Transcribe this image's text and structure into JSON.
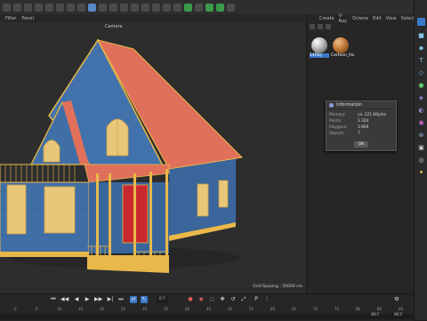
{
  "toolbar": {
    "icons": [
      "undo-icon",
      "move-icon",
      "scale-icon",
      "rotate-icon",
      "mode-icon",
      "brush-icon",
      "x-axis-icon",
      "y-axis-icon",
      "z-axis-icon",
      "coord-icon",
      "render-icon",
      "render-settings-icon",
      "edit-render-icon",
      "cube-icon",
      "pen-icon",
      "subdivide-icon",
      "bend-icon",
      "field-icon",
      "camera-icon",
      "light-icon",
      "brush-tool-icon",
      "snap-icon"
    ]
  },
  "viewport": {
    "menu": [
      "Filter",
      "Panel"
    ],
    "camera_label": "Camera",
    "grid_spacing": "Grid Spacing : 50000 cm"
  },
  "material_panel": {
    "menu": [
      "Create",
      "V-Ray",
      "Octane",
      "Edit",
      "View",
      "Select"
    ],
    "materials": [
      {
        "name": "24Ray",
        "selected": true
      },
      {
        "name": "Cartoon_Ho",
        "selected": false
      }
    ]
  },
  "info_dialog": {
    "title": "Information",
    "rows": [
      {
        "key": "Memory:",
        "value": "ca. 221 KBytes"
      },
      {
        "key": "Points:",
        "value": "3 324"
      },
      {
        "key": "Polygons:",
        "value": "3 869"
      },
      {
        "key": "Objects:",
        "value": "7"
      }
    ],
    "ok_label": "OK"
  },
  "timeline": {
    "current_frame": "0 F",
    "end_frame_1": "90 F",
    "end_frame_2": "90 F",
    "ruler": [
      "0",
      "5",
      "10",
      "15",
      "20",
      "25",
      "30",
      "35",
      "40",
      "45",
      "50",
      "55",
      "60",
      "65",
      "70",
      "75",
      "80",
      "85",
      "90"
    ]
  },
  "colors": {
    "roof": "#e0705a",
    "wall": "#3f6fa6",
    "trim": "#e8b84a",
    "door": "#c8282e",
    "window": "#e9c77a",
    "accent": "#3a78c9"
  }
}
